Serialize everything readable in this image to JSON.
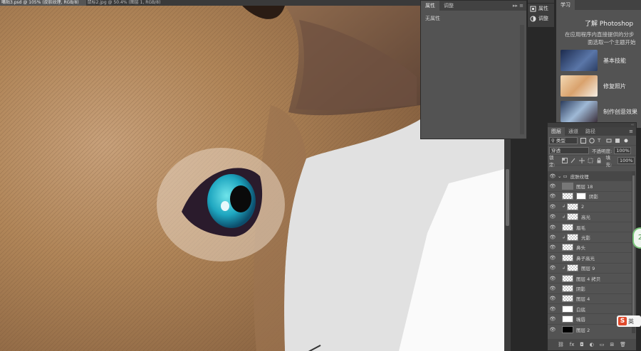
{
  "document_tabs": [
    {
      "label": "嘴贴3.psd @ 105% (皮肤纹理, RGB/8)",
      "active": true
    },
    {
      "label": "鼠标2.jpg @ 50.4% (图层 1, RGB/8)",
      "active": false
    }
  ],
  "properties_panel": {
    "tabs": [
      "属性",
      "调整"
    ],
    "collapse": "▸▸ ≡",
    "body_text": "无属性"
  },
  "dock": {
    "items": [
      {
        "label": "属性",
        "icon": "properties-icon"
      },
      {
        "label": "调整",
        "icon": "adjustments-icon"
      }
    ]
  },
  "learn_panel": {
    "tab": "学习",
    "title": "了解 Photoshop",
    "desc_line1": "在应用程序内直接提供的分步",
    "desc_line2": "面选取一个主题开始",
    "cards": [
      {
        "label": "基本技能"
      },
      {
        "label": "修复照片"
      },
      {
        "label": "制作创意效果"
      }
    ]
  },
  "layers_panel": {
    "tabs": [
      "图层",
      "通道",
      "路径"
    ],
    "menu": "≡",
    "filter_kind": "类型",
    "blend_mode": "穿透",
    "opacity_label": "不透明度:",
    "opacity_value": "100%",
    "lock_label": "锁定:",
    "fill_label": "填充:",
    "fill_value": "100%",
    "layers": [
      {
        "name": "皮肤纹理",
        "type": "group"
      },
      {
        "name": "图层 18",
        "type": "gray"
      },
      {
        "name": "阴影",
        "type": "masked"
      },
      {
        "name": "2",
        "type": "clip"
      },
      {
        "name": "高光",
        "type": "clip"
      },
      {
        "name": "眉毛",
        "type": "normal"
      },
      {
        "name": "光影",
        "type": "clip"
      },
      {
        "name": "鼻头",
        "type": "normal"
      },
      {
        "name": "鼻子高光",
        "type": "normal"
      },
      {
        "name": "图层 9",
        "type": "clip"
      },
      {
        "name": "图层 4 拷贝",
        "type": "normal"
      },
      {
        "name": "阴影",
        "type": "normal"
      },
      {
        "name": "图层 4",
        "type": "normal"
      },
      {
        "name": "白底",
        "type": "white"
      },
      {
        "name": "嘴唇",
        "type": "white"
      },
      {
        "name": "图层 2",
        "type": "black"
      }
    ],
    "footer_icons": [
      "link-icon",
      "fx-icon",
      "mask-icon",
      "adjustment-icon",
      "folder-icon",
      "new-layer-icon",
      "trash-icon"
    ]
  },
  "floating_badge": {
    "text": "2"
  },
  "ime": {
    "logo": "S",
    "label": "英"
  }
}
